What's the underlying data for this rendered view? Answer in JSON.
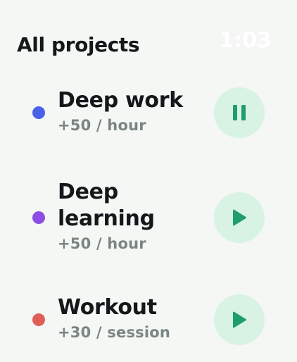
{
  "header": {
    "title": "All projects",
    "time": "1:03"
  },
  "colors": {
    "accent_green": "#1f9e6c",
    "button_bg": "#d8f3e4"
  },
  "projects": [
    {
      "name": "Deep work",
      "rate": "+50 / hour",
      "color": "#4a62ea",
      "state": "playing",
      "button_icon": "pause-icon"
    },
    {
      "name": "Deep learning",
      "rate": "+50 / hour",
      "color": "#8b4de3",
      "state": "stopped",
      "button_icon": "play-icon"
    },
    {
      "name": "Workout",
      "rate": "+30 / session",
      "color": "#df5f57",
      "state": "stopped",
      "button_icon": "play-icon"
    }
  ]
}
